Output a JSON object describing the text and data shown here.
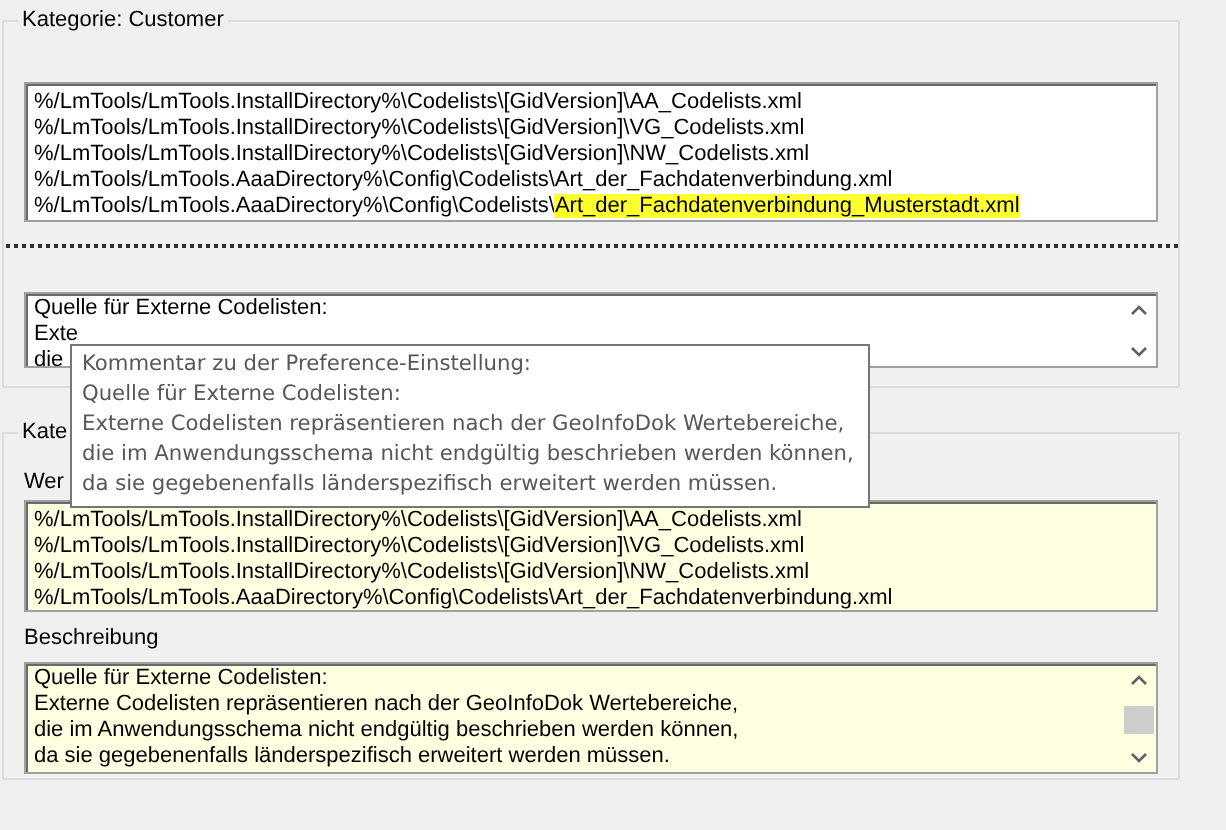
{
  "category_customer": {
    "title": "Kategorie: Customer",
    "value_lines": [
      {
        "text": "%/LmTools/LmTools.InstallDirectory%\\Codelists\\[GidVersion]\\AA_Codelists.xml"
      },
      {
        "text": "%/LmTools/LmTools.InstallDirectory%\\Codelists\\[GidVersion]\\VG_Codelists.xml"
      },
      {
        "text": "%/LmTools/LmTools.InstallDirectory%\\Codelists\\[GidVersion]\\NW_Codelists.xml"
      },
      {
        "text": "%/LmTools/LmTools.AaaDirectory%\\Config\\Codelists\\Art_der_Fachdatenverbindung.xml"
      },
      {
        "text": "%/LmTools/LmTools.AaaDirectory%\\Config\\Codelists\\",
        "highlighted_part": "Art_der_Fachdatenverbindung_Musterstadt.xml"
      }
    ],
    "description_lines": [
      "Quelle für Externe Codelisten:",
      "Exte",
      "die"
    ]
  },
  "category_second": {
    "title": "Kate",
    "value_label": "Wer",
    "value_lines": [
      "%/LmTools/LmTools.InstallDirectory%\\Codelists\\[GidVersion]\\AA_Codelists.xml",
      "%/LmTools/LmTools.InstallDirectory%\\Codelists\\[GidVersion]\\VG_Codelists.xml",
      "%/LmTools/LmTools.InstallDirectory%\\Codelists\\[GidVersion]\\NW_Codelists.xml",
      "%/LmTools/LmTools.AaaDirectory%\\Config\\Codelists\\Art_der_Fachdatenverbindung.xml"
    ],
    "description_label": "Beschreibung",
    "description_lines": [
      "Quelle für Externe Codelisten:",
      "Externe Codelisten repräsentieren nach der GeoInfoDok Wertebereiche,",
      "die im Anwendungsschema nicht endgültig beschrieben werden können,",
      "da sie gegebenenfalls länderspezifisch erweitert werden müssen."
    ]
  },
  "tooltip": {
    "lines": [
      "Kommentar zu der Preference-Einstellung:",
      "Quelle für Externe Codelisten:",
      "Externe Codelisten repräsentieren nach der GeoInfoDok Wertebereiche,",
      "die im Anwendungsschema nicht endgültig beschrieben werden können,",
      "da sie gegebenenfalls länderspezifisch erweitert werden müssen."
    ]
  }
}
